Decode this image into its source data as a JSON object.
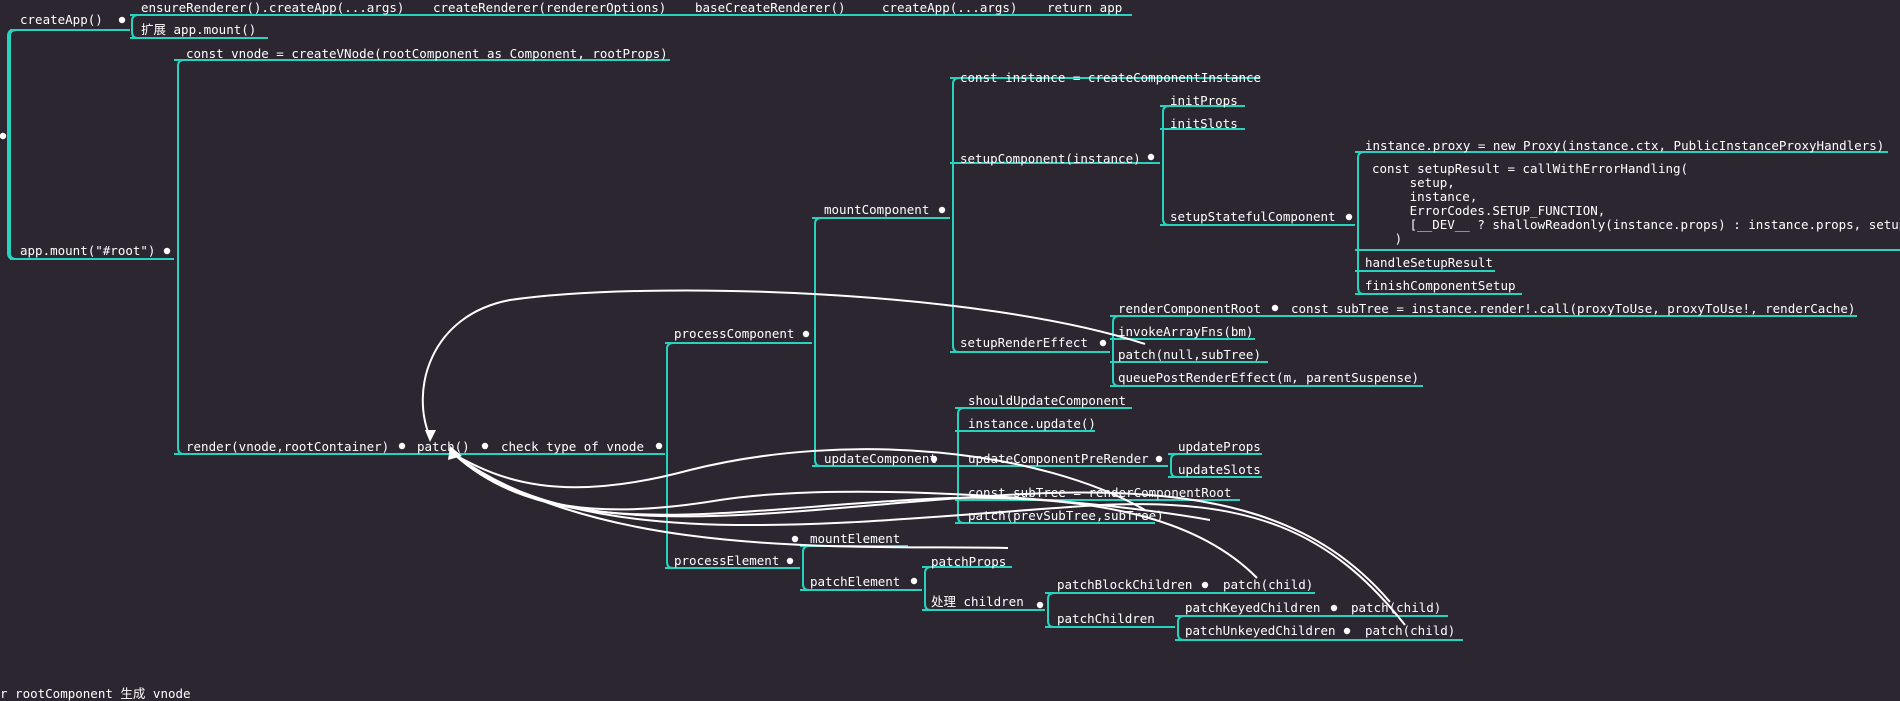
{
  "colors": {
    "background": "#2c2631",
    "edge": "#27d3be",
    "text": "#ffffff",
    "arrow": "#ffffff"
  },
  "note": "r rootComponent 生成 vnode",
  "nodes": {
    "createApp": "createApp()",
    "ensureRenderer": "ensureRenderer().createApp(...args)",
    "createRenderer": "createRenderer(rendererOptions)",
    "baseCreateRenderer": "baseCreateRenderer()",
    "createAppArgs": "createApp(...args)",
    "returnApp": "return app",
    "extendMount": "扩展 app.mount()",
    "appMount": "app.mount(\"#root\")",
    "createVNode": "const vnode = createVNode(rootComponent as Component, rootProps)",
    "render": "render(vnode,rootContainer)",
    "patch": "patch()",
    "checkType": "check type of vnode",
    "processComponent": "processComponent",
    "mountComponent": "mountComponent",
    "createComponentInstance": "const instance = createComponentInstance",
    "setupComponent": "setupComponent(instance)",
    "initProps": "initProps",
    "initSlots": "initSlots",
    "setupStatefulComponent": "setupStatefulComponent",
    "instanceProxy": "instance.proxy = new Proxy(instance.ctx, PublicInstanceProxyHandlers)",
    "setupResult": "const setupResult = callWithErrorHandling(\n     setup,\n     instance,\n     ErrorCodes.SETUP_FUNCTION,\n     [__DEV__ ? shallowReadonly(instance.props) : instance.props, setupContext]\n   )",
    "handleSetupResult": "handleSetupResult",
    "finishComponentSetup": "finishComponentSetup",
    "setupRenderEffect": "setupRenderEffect",
    "renderComponentRoot": "renderComponentRoot",
    "subTreeRender": "const subTree = instance.render!.call(proxyToUse, proxyToUse!, renderCache)",
    "invokeArrayFns": "invokeArrayFns(bm)",
    "patchNullSubTree": "patch(null,subTree)",
    "queuePostRenderEffect": "queuePostRenderEffect(m, parentSuspense)",
    "updateComponent": "updateComponent",
    "shouldUpdateComponent": "shouldUpdateComponent",
    "instanceUpdate": "instance.update()",
    "updateComponentPreRender": "updateComponentPreRender",
    "updateProps": "updateProps",
    "updateSlots": "updateSlots",
    "nextTreeRoot": "const subTree = renderComponentRoot",
    "patchPrevSubTree": "patch(prevSubTree,subTree)",
    "processElement": "processElement",
    "mountElement": "mountElement",
    "patchElement": "patchElement",
    "patchProps": "patchProps",
    "handleChildren": "处理 children",
    "patchBlockChildren": "patchBlockChildren",
    "patchChildBlock": "patch(child)",
    "patchChildren": "patchChildren",
    "patchKeyedChildren": "patchKeyedChildren",
    "patchChildKeyed": "patch(child)",
    "patchUnkeyedChildren": "patchUnkeyedChildren",
    "patchChildUnkeyed": "patch(child)"
  }
}
